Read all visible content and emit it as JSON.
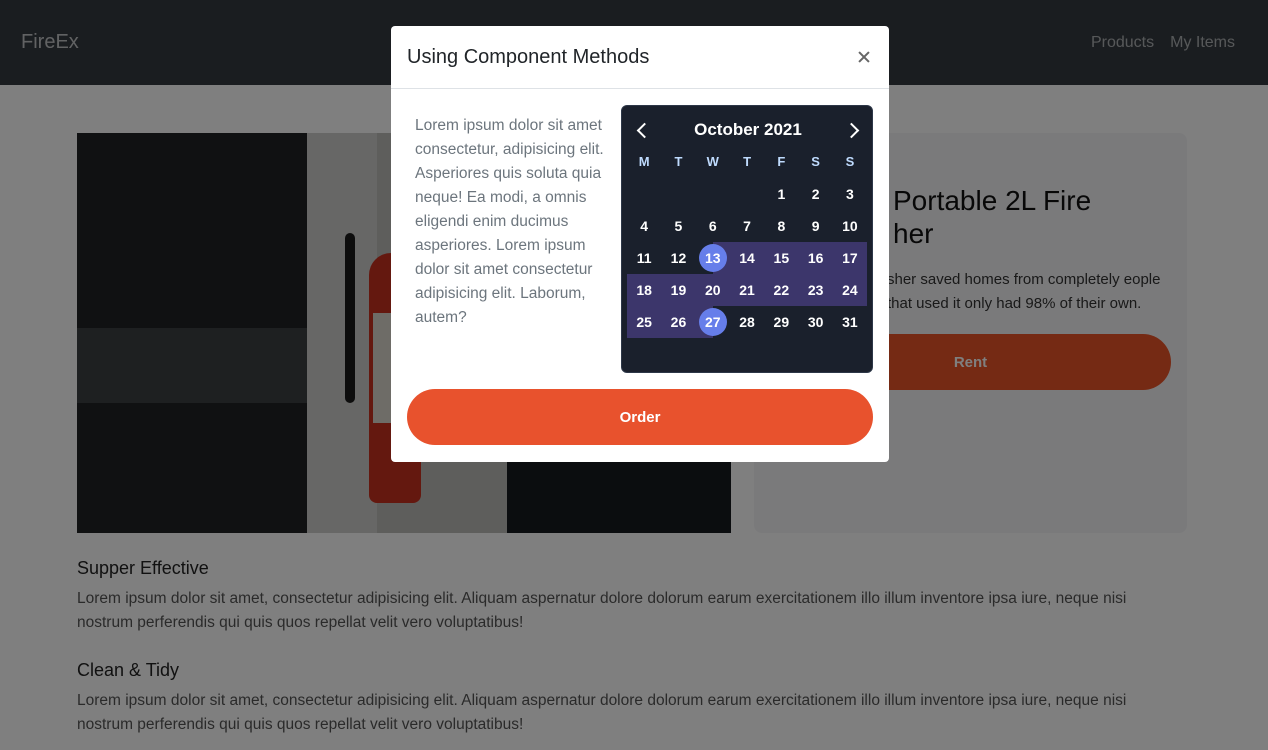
{
  "navbar": {
    "brand": "FireEx",
    "links": [
      "Products",
      "My Items"
    ]
  },
  "product": {
    "title": "Portable 2L Fire Extinguisher",
    "title_visible": "Portable 2L Fire\nher",
    "description_visible": "sher saved homes from completely eople that used it only had 98% of their own.",
    "rent_label": "Rent"
  },
  "features": [
    {
      "heading": "Supper Effective",
      "text": "Lorem ipsum dolor sit amet, consectetur adipisicing elit. Aliquam aspernatur dolore dolorum earum exercitationem illo illum inventore ipsa iure, neque nisi nostrum perferendis qui quis quos repellat velit vero voluptatibus!"
    },
    {
      "heading": "Clean & Tidy",
      "text": "Lorem ipsum dolor sit amet, consectetur adipisicing elit. Aliquam aspernatur dolore dolorum earum exercitationem illo illum inventore ipsa iure, neque nisi nostrum perferendis qui quis quos repellat velit vero voluptatibus!"
    }
  ],
  "modal": {
    "title": "Using Component Methods",
    "body_text": "Lorem ipsum dolor sit amet consectetur, adipisicing elit. Asperiores quis soluta quia neque! Ea modi, a omnis eligendi enim ducimus asperiores. Lorem ipsum dolor sit amet consectetur adipisicing elit. Laborum, autem?",
    "order_label": "Order",
    "calendar": {
      "month_label": "October 2021",
      "weekdays": [
        "M",
        "T",
        "W",
        "T",
        "F",
        "S",
        "S"
      ],
      "leading_blanks": 4,
      "days_in_month": 31,
      "range_start": 13,
      "range_end": 27
    }
  },
  "colors": {
    "navbar": "#343a40",
    "accent": "#e8522d",
    "calendar_bg": "#1a202c",
    "range_bg": "#3c366b",
    "selected": "#667eea"
  }
}
